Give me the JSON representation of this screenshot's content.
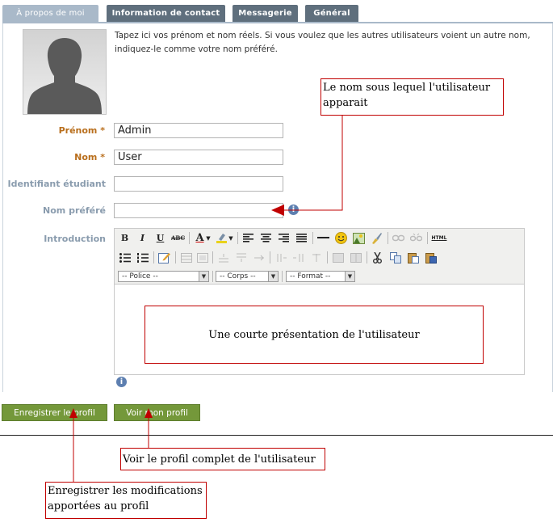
{
  "tabs": [
    {
      "label": "À propos de moi",
      "active": true
    },
    {
      "label": "Information de contact",
      "active": false
    },
    {
      "label": "Messagerie",
      "active": false
    },
    {
      "label": "Général",
      "active": false
    }
  ],
  "help_text": "Tapez ici vos prénom et nom réels. Si vous voulez que les autres utilisateurs voient un autre nom, indiquez-le comme votre nom préféré.",
  "fields": {
    "prenom": {
      "label": "Prénom",
      "required_mark": "*",
      "value": "Admin"
    },
    "nom": {
      "label": "Nom",
      "required_mark": "*",
      "value": "User"
    },
    "identifiant": {
      "label": "Identifiant étudiant",
      "value": ""
    },
    "nom_prefere": {
      "label": "Nom préféré",
      "value": ""
    },
    "introduction": {
      "label": "Introduction"
    }
  },
  "editor": {
    "bold": "B",
    "italic": "I",
    "underline": "U",
    "strike": "ABC",
    "font_color": "A",
    "html_label": "HTML",
    "dropdowns": {
      "police": "-- Police --",
      "corps": "-- Corps --",
      "format": "-- Format --"
    }
  },
  "info_glyph": "i",
  "buttons": {
    "save": "Enregistrer le profil",
    "view": "Voir mon profil"
  },
  "annotations": {
    "nom_prefere": "Le nom sous lequel l'utilisateur apparait",
    "introduction": "Une courte présentation de l'utilisateur",
    "view": "Voir le profil complet de l'utilisateur",
    "save": "Enregistrer les modifications apportées au profil"
  },
  "colors": {
    "tab": "#5f6f7d",
    "tab_active": "#a9b9c9",
    "required_label": "#b96f1d",
    "optional_label": "#8a9cae",
    "button": "#74983a",
    "callout": "#c00000"
  }
}
